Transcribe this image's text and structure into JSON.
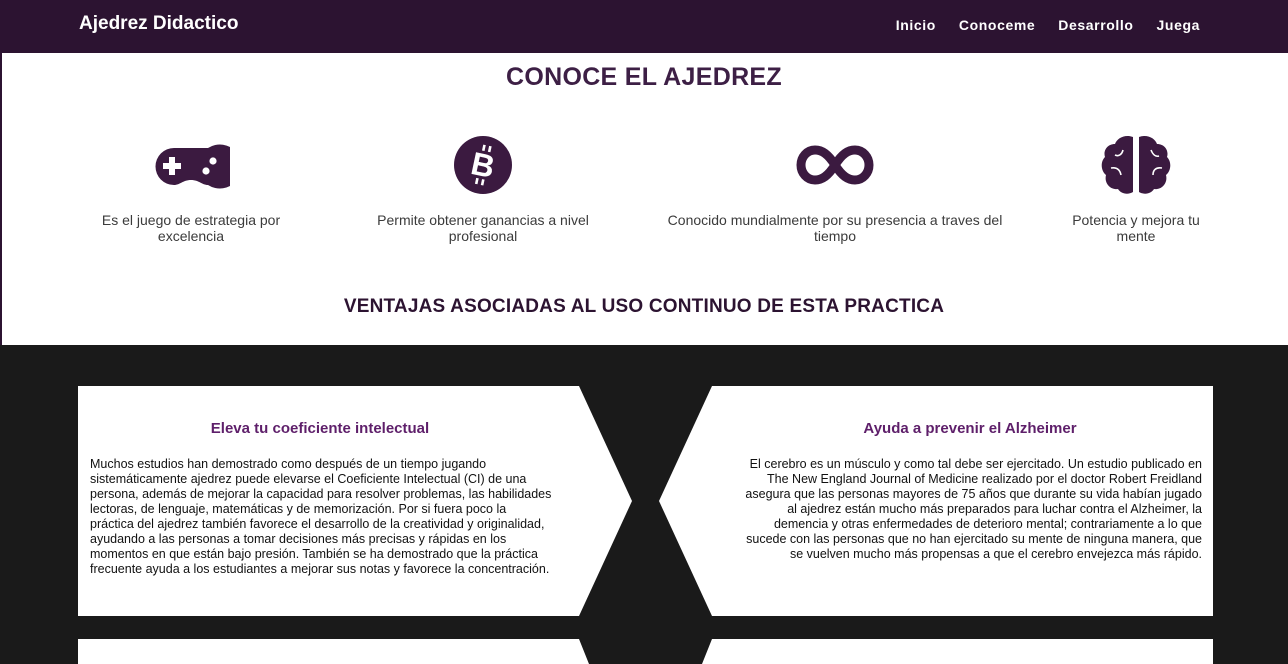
{
  "navbar": {
    "brand": "Ajedrez Didactico",
    "links": [
      "Inicio",
      "Conoceme",
      "Desarrollo",
      "Juega"
    ]
  },
  "colors": {
    "primary": "#2c1331",
    "accent": "#5e1f6a",
    "dark_band": "#1a1a1a"
  },
  "hero": {
    "title": "CONOCE EL AJEDREZ",
    "features": [
      {
        "icon": "gamepad-icon",
        "text": "Es el juego de estrategia por excelencia"
      },
      {
        "icon": "bitcoin-icon",
        "text": "Permite obtener ganancias a nivel profesional"
      },
      {
        "icon": "infinity-icon",
        "text": "Conocido mundialmente por su presencia a traves del tiempo"
      },
      {
        "icon": "brain-icon",
        "text": "Potencia y mejora tu mente"
      }
    ],
    "subtitle": "VENTAJAS ASOCIADAS AL USO CONTINUO DE ESTA PRACTICA"
  },
  "cards": [
    {
      "title": "Eleva tu coeficiente intelectual",
      "text": "Muchos estudios han demostrado como después de un tiempo jugando sistemáticamente ajedrez puede elevarse el Coeficiente Intelectual (CI) de una persona, además de mejorar la capacidad para resolver problemas, las habilidades lectoras, de lenguaje, matemáticas y de memorización. Por si fuera poco la práctica del ajedrez también favorece el desarrollo de la creatividad y originalidad, ayudando a las personas a tomar decisiones más precisas y rápidas en los momentos en que están bajo presión. También se ha demostrado que la práctica frecuente ayuda a los estudiantes a mejorar sus notas y favorece la concentración."
    },
    {
      "title": "Ayuda a prevenir el Alzheimer",
      "text": "El cerebro es un músculo y como tal debe ser ejercitado. Un estudio publicado en The New England Journal of Medicine realizado por el doctor Robert Freidland asegura que las personas mayores de 75 años que durante su vida habían jugado al ajedrez están mucho más preparados para luchar contra el Alzheimer, la demencia y otras enfermedades de deterioro mental; contrariamente a lo que sucede con las personas que no han ejercitado su mente de ninguna manera, que se vuelven mucho más propensas a que el cerebro envejezca más rápido."
    }
  ]
}
